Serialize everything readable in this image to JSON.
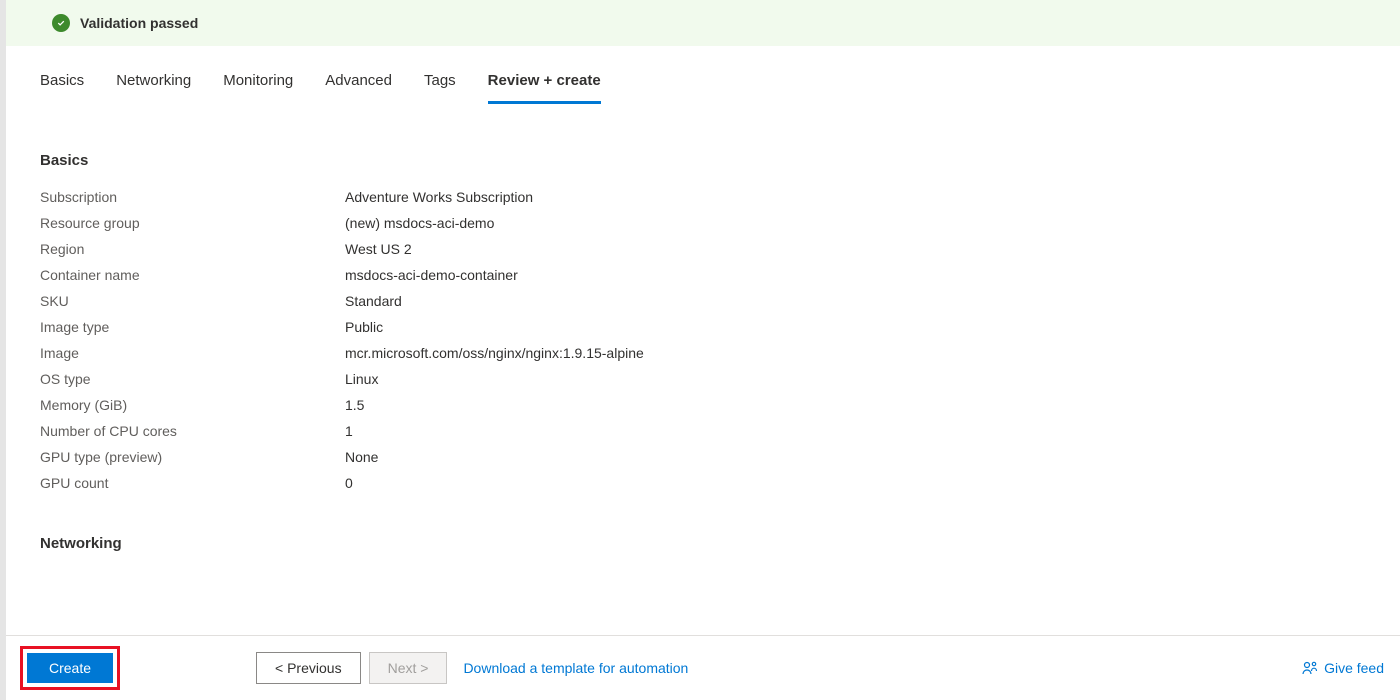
{
  "validation": {
    "message": "Validation passed"
  },
  "tabs": [
    {
      "label": "Basics"
    },
    {
      "label": "Networking"
    },
    {
      "label": "Monitoring"
    },
    {
      "label": "Advanced"
    },
    {
      "label": "Tags"
    },
    {
      "label": "Review + create"
    }
  ],
  "sections": {
    "basics": {
      "heading": "Basics",
      "rows": [
        {
          "label": "Subscription",
          "value": "Adventure Works Subscription"
        },
        {
          "label": "Resource group",
          "value": "(new) msdocs-aci-demo"
        },
        {
          "label": "Region",
          "value": "West US 2"
        },
        {
          "label": "Container name",
          "value": "msdocs-aci-demo-container"
        },
        {
          "label": "SKU",
          "value": "Standard"
        },
        {
          "label": "Image type",
          "value": "Public"
        },
        {
          "label": "Image",
          "value": "mcr.microsoft.com/oss/nginx/nginx:1.9.15-alpine"
        },
        {
          "label": "OS type",
          "value": "Linux"
        },
        {
          "label": "Memory (GiB)",
          "value": "1.5"
        },
        {
          "label": "Number of CPU cores",
          "value": "1"
        },
        {
          "label": "GPU type (preview)",
          "value": "None"
        },
        {
          "label": "GPU count",
          "value": "0"
        }
      ]
    },
    "networking": {
      "heading": "Networking"
    }
  },
  "footer": {
    "create": "Create",
    "previous": "< Previous",
    "next": "Next >",
    "download_template": "Download a template for automation",
    "give_feedback": "Give feed"
  }
}
